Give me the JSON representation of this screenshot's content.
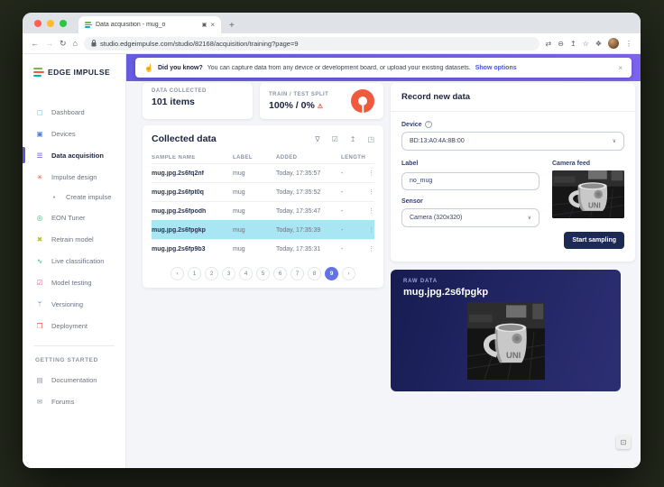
{
  "browser": {
    "tab_title": "Data acquisition - mug_o",
    "url": "studio.edgeimpulse.com/studio/82168/acquisition/training?page=9"
  },
  "icons": {
    "plus": "+",
    "close": "×",
    "tab_indicator": "▣",
    "back": "←",
    "forward": "→",
    "reload": "↻",
    "home": "⌂",
    "translate": "⇄",
    "zoom_out": "⊖",
    "share": "↥",
    "star": "☆",
    "extensions": "❖",
    "menu": "⋮",
    "filter": "∇",
    "select_all": "☑",
    "upload": "↥",
    "expand": "◳",
    "kebab": "⋮",
    "chevron_down": "∨",
    "warning": "⚠",
    "prev": "‹",
    "next": "›",
    "help": "?",
    "banner": "☝",
    "widget": "⊡"
  },
  "banner": {
    "bold": "Did you know?",
    "text": "You can capture data from any device or development board, or upload your existing datasets.",
    "link": "Show options"
  },
  "sidebar": {
    "logo_text": "EDGE IMPULSE",
    "items": [
      {
        "label": "Dashboard",
        "icon": "▢",
        "icon_style": "color:#53c6ec"
      },
      {
        "label": "Devices",
        "icon": "▣",
        "icon_style": "color:#4a7de8"
      },
      {
        "label": "Data acquisition",
        "icon": "☰",
        "icon_style": "color:#5a54d6"
      },
      {
        "label": "Impulse design",
        "icon": "✳",
        "icon_style": "color:#f0593c"
      },
      {
        "label": "Create impulse",
        "icon": "●",
        "icon_style": "color:#9aa2b1;font-size:5px"
      },
      {
        "label": "EON Tuner",
        "icon": "◎",
        "icon_style": "color:#2bb271"
      },
      {
        "label": "Retrain model",
        "icon": "✖",
        "icon_style": "color:#b9c61f"
      },
      {
        "label": "Live classification",
        "icon": "∿",
        "icon_style": "color:#2bb271"
      },
      {
        "label": "Model testing",
        "icon": "☑",
        "icon_style": "color:#ef5b82"
      },
      {
        "label": "Versioning",
        "icon": "ᛘ",
        "icon_style": "color:#4a7de8"
      },
      {
        "label": "Deployment",
        "icon": "❒",
        "icon_style": "color:#f0593c"
      }
    ],
    "getting_started": {
      "section": "GETTING STARTED",
      "items": [
        {
          "label": "Documentation",
          "icon": "▤",
          "icon_style": "color:#8a93a6"
        },
        {
          "label": "Forums",
          "icon": "✉",
          "icon_style": "color:#8a93a6"
        }
      ]
    }
  },
  "stats": {
    "collected_label": "DATA COLLECTED",
    "collected_value": "101 items",
    "split_label": "TRAIN / TEST SPLIT",
    "split_value": "100% / 0%",
    "split_train_pct": 100,
    "split_test_pct": 0
  },
  "collected": {
    "title": "Collected data",
    "columns": [
      "SAMPLE NAME",
      "LABEL",
      "ADDED",
      "LENGTH"
    ],
    "rows": [
      {
        "name": "mug.jpg.2s6fq2nf",
        "label": "mug",
        "added": "Today, 17:35:57",
        "length": "-"
      },
      {
        "name": "mug.jpg.2s6fpt0q",
        "label": "mug",
        "added": "Today, 17:35:52",
        "length": "-"
      },
      {
        "name": "mug.jpg.2s6fpodh",
        "label": "mug",
        "added": "Today, 17:35:47",
        "length": "-"
      },
      {
        "name": "mug.jpg.2s6fpgkp",
        "label": "mug",
        "added": "Today, 17:35:39",
        "length": "-"
      },
      {
        "name": "mug.jpg.2s6fp9b3",
        "label": "mug",
        "added": "Today, 17:35:31",
        "length": "-"
      }
    ],
    "selected_row": "mug.jpg.2s6fpgkp",
    "pagination": {
      "pages": [
        "1",
        "2",
        "3",
        "4",
        "5",
        "6",
        "7",
        "8",
        "9"
      ],
      "active": "9"
    }
  },
  "record": {
    "title": "Record new data",
    "device_label": "Device",
    "device_value": "BD:13:A0:4A:8B:00",
    "label_label": "Label",
    "label_value": "no_mug",
    "sensor_label": "Sensor",
    "sensor_value": "Camera (320x320)",
    "camera_label": "Camera feed",
    "button": "Start sampling"
  },
  "raw": {
    "label": "RAW DATA",
    "title": "mug.jpg.2s6fpgkp"
  },
  "colors": {
    "accent_purple": "#655ce0",
    "active_nav": "#5a54d6",
    "donut_train": "#f0593c",
    "selected_row": "#a9e6f4",
    "active_page": "#6273e8",
    "navy_button": "#1d2a55",
    "link_blue": "#4754e0"
  }
}
